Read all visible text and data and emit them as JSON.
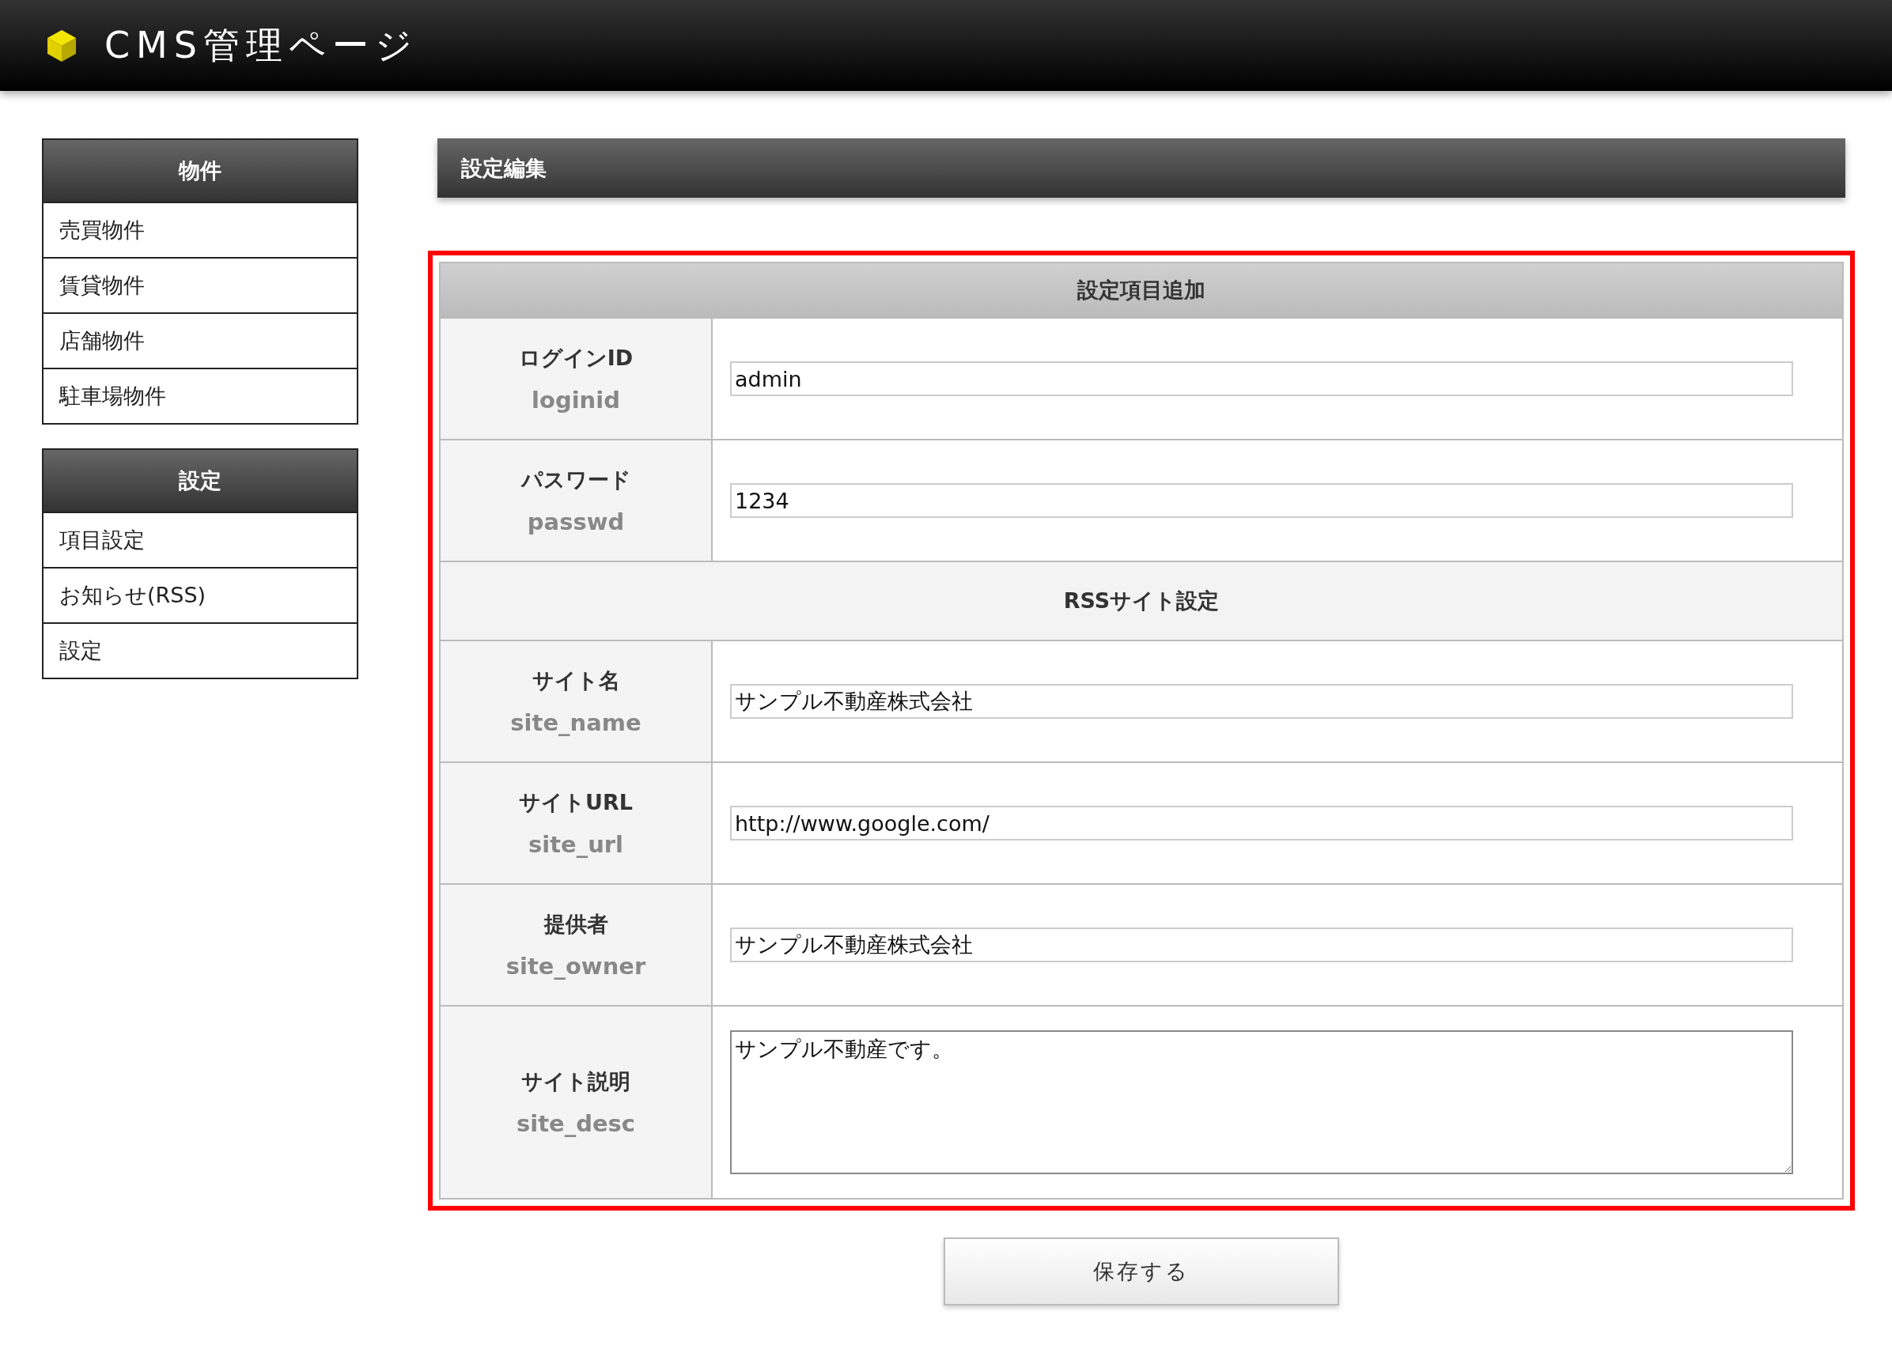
{
  "header": {
    "title": "CMS管理ページ"
  },
  "sidebar": {
    "sections": [
      {
        "heading": "物件",
        "items": [
          "売買物件",
          "賃貸物件",
          "店舗物件",
          "駐車場物件"
        ]
      },
      {
        "heading": "設定",
        "items": [
          "項目設定",
          "お知らせ(RSS)",
          "設定"
        ]
      }
    ]
  },
  "page_title": "設定編集",
  "form": {
    "caption": "設定項目追加",
    "rows": [
      {
        "kind": "input",
        "label": "ログインID",
        "key": "loginid",
        "value": "admin"
      },
      {
        "kind": "input",
        "label": "パスワード",
        "key": "passwd",
        "value": "1234"
      },
      {
        "kind": "section",
        "label": "RSSサイト設定"
      },
      {
        "kind": "input",
        "label": "サイト名",
        "key": "site_name",
        "value": "サンプル不動産株式会社"
      },
      {
        "kind": "input",
        "label": "サイトURL",
        "key": "site_url",
        "value": "http://www.google.com/"
      },
      {
        "kind": "input",
        "label": "提供者",
        "key": "site_owner",
        "value": "サンプル不動産株式会社"
      },
      {
        "kind": "textarea",
        "label": "サイト説明",
        "key": "site_desc",
        "value": "サンプル不動産です。"
      }
    ]
  },
  "save_button": "保存する"
}
